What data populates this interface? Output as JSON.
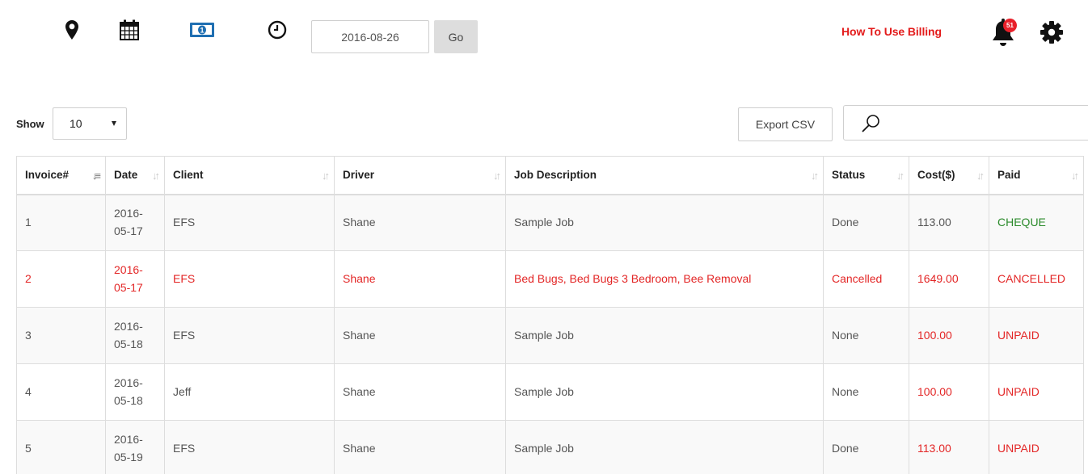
{
  "toolbar": {
    "icons": [
      "map-marker-icon",
      "calendar-icon",
      "money-icon",
      "clock-icon"
    ],
    "date_value": "2016-08-26",
    "go_label": "Go",
    "help_link": "How To Use Billing",
    "notification_count": "51",
    "colors": {
      "help_link": "#e31b1b",
      "money_icon": "#1f6fb2",
      "badge": "#e8202a"
    }
  },
  "controls": {
    "show_label": "Show",
    "show_value": "10",
    "export_label": "Export CSV",
    "search_value": ""
  },
  "table": {
    "columns": [
      "Invoice#",
      "Date",
      "Client",
      "Driver",
      "Job Description",
      "Status",
      "Cost($)",
      "Paid"
    ],
    "rows": [
      {
        "invoice": "1",
        "date_a": "2016-",
        "date_b": "05-17",
        "client": "EFS",
        "driver": "Shane",
        "job": "Sample Job",
        "status": "Done",
        "cost": "113.00",
        "paid": "CHEQUE"
      },
      {
        "invoice": "2",
        "date_a": "2016-",
        "date_b": "05-17",
        "client": "EFS",
        "driver": "Shane",
        "job": "Bed Bugs, Bed Bugs 3 Bedroom, Bee Removal",
        "status": "Cancelled",
        "cost": "1649.00",
        "paid": "CANCELLED"
      },
      {
        "invoice": "3",
        "date_a": "2016-",
        "date_b": "05-18",
        "client": "EFS",
        "driver": "Shane",
        "job": "Sample Job",
        "status": "None",
        "cost": "100.00",
        "paid": "UNPAID"
      },
      {
        "invoice": "4",
        "date_a": "2016-",
        "date_b": "05-18",
        "client": "Jeff",
        "driver": "Shane",
        "job": "Sample Job",
        "status": "None",
        "cost": "100.00",
        "paid": "UNPAID"
      },
      {
        "invoice": "5",
        "date_a": "2016-",
        "date_b": "05-19",
        "client": "EFS",
        "driver": "Shane",
        "job": "Sample Job",
        "status": "Done",
        "cost": "113.00",
        "paid": "UNPAID"
      }
    ],
    "colors": {
      "paid_green": "#2a8a2a",
      "alert_red": "#e32626"
    }
  }
}
